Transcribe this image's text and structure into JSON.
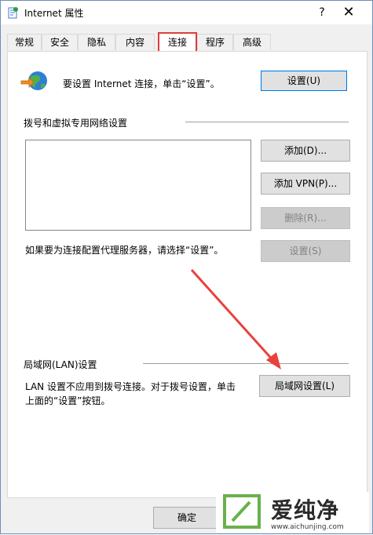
{
  "window": {
    "title": "Internet 属性",
    "help_label": "?",
    "close_label": "✕"
  },
  "tabs": [
    {
      "label": "常规"
    },
    {
      "label": "安全"
    },
    {
      "label": "隐私"
    },
    {
      "label": "内容"
    },
    {
      "label": "连接",
      "active": true
    },
    {
      "label": "程序"
    },
    {
      "label": "高级"
    }
  ],
  "setup": {
    "text": "要设置 Internet 连接，单击“设置”。",
    "button": "设置(U)",
    "icon": "internet-globe-icon"
  },
  "dialup": {
    "heading": "拨号和虚拟专用网络设置",
    "add_button": "添加(D)...",
    "add_vpn_button": "添加 VPN(P)...",
    "delete_button": "删除(R)...",
    "proxy_text": "如果要为连接配置代理服务器，请选择“设置”。",
    "settings_button": "设置(S)"
  },
  "lan": {
    "heading": "局域网(LAN)设置",
    "text_line1": "LAN 设置不应用到拨号连接。对于拨号设置，单击",
    "text_line2": "上面的“设置”按钮。",
    "button": "局域网设置(L)"
  },
  "footer": {
    "ok_button": "确定"
  },
  "watermark": {
    "text": "爱纯净",
    "url": "www.aichunjing.com"
  },
  "colors": {
    "highlight": "#e13b3b",
    "arrow": "#e8413e",
    "accent": "#0078d7",
    "watermark_green": "#6ab04c"
  }
}
